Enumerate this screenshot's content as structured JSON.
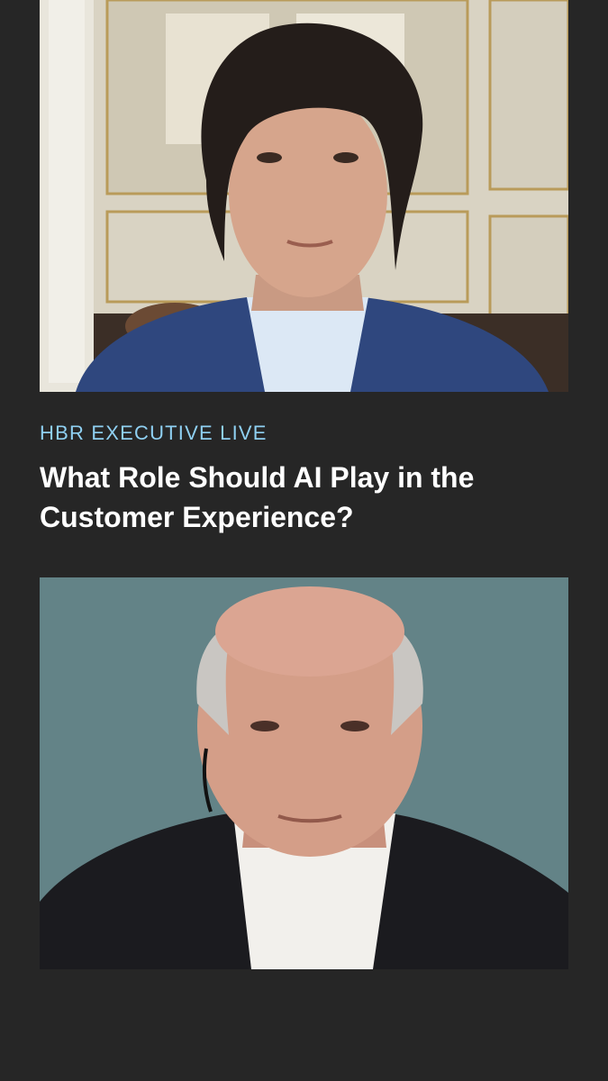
{
  "header": {
    "kicker": "HBR EXECUTIVE LIVE",
    "title": "What Role Should AI Play in the Customer Experience?"
  },
  "colors": {
    "background": "#262626",
    "kicker": "#8fd0f2",
    "title": "#ffffff"
  },
  "video_tiles": [
    {
      "id": "top",
      "subject": "man-dark-hair-blue-blazer-in-room"
    },
    {
      "id": "bottom",
      "subject": "man-bald-dark-blazer-on-teal-backdrop"
    }
  ]
}
